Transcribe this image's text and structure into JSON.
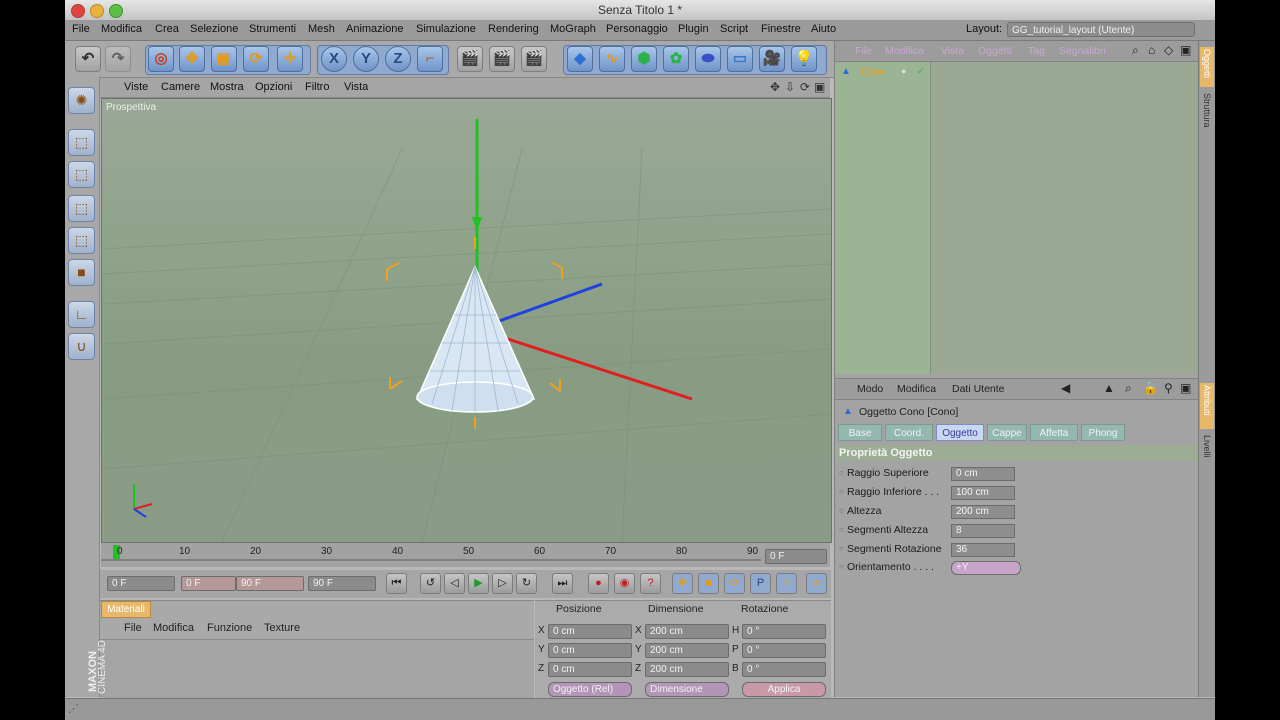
{
  "window": {
    "title": "Senza Titolo 1 *"
  },
  "menubar": {
    "items": [
      "File",
      "Modifica",
      "Crea",
      "Selezione",
      "Strumenti",
      "Mesh",
      "Animazione",
      "Simulazione",
      "Rendering",
      "MoGraph",
      "Personaggio",
      "Plugin",
      "Script",
      "Finestre",
      "Aiuto"
    ],
    "layout_label": "Layout:",
    "layout_value": "GG_tutorial_layout (Utente)"
  },
  "viewport": {
    "menu": [
      "Viste",
      "Camere",
      "Mostra",
      "Opzioni",
      "Filtro",
      "Vista"
    ],
    "label": "Prospettiva"
  },
  "timeline": {
    "ticks": [
      "0",
      "10",
      "20",
      "30",
      "40",
      "50",
      "60",
      "70",
      "80",
      "90"
    ],
    "current_frame": "0 F"
  },
  "playback": {
    "start": "0 F",
    "range_start": "0 F",
    "range_end": "90 F",
    "end": "90 F"
  },
  "materials": {
    "tab": "Materiali",
    "menu": [
      "File",
      "Modifica",
      "Funzione",
      "Texture"
    ]
  },
  "coordinates": {
    "headers": [
      "Posizione",
      "Dimensione",
      "Rotazione"
    ],
    "rows": [
      {
        "axis": "X",
        "pos": "0 cm",
        "dim_axis": "X",
        "dim": "200 cm",
        "rot_axis": "H",
        "rot": "0 °"
      },
      {
        "axis": "Y",
        "pos": "0 cm",
        "dim_axis": "Y",
        "dim": "200 cm",
        "rot_axis": "P",
        "rot": "0 °"
      },
      {
        "axis": "Z",
        "pos": "0 cm",
        "dim_axis": "Z",
        "dim": "200 cm",
        "rot_axis": "B",
        "rot": "0 °"
      }
    ],
    "mode_object": "Oggetto (Rel)",
    "mode_size": "Dimensione",
    "apply": "Applica"
  },
  "objects": {
    "menu": [
      "File",
      "Modifica",
      "Vista",
      "Oggetti",
      "Tag",
      "Segnalibri"
    ],
    "items": [
      {
        "name": "Cono"
      }
    ]
  },
  "attributes": {
    "menu": [
      "Modo",
      "Modifica",
      "Dati Utente"
    ],
    "object_title": "Oggetto Cono [Cono]",
    "tabs": [
      "Base",
      "Coord.",
      "Oggetto",
      "Cappe",
      "Affetta",
      "Phong"
    ],
    "active_tab": "Oggetto",
    "section": "Proprietà Oggetto",
    "props": [
      {
        "label": "Raggio Superiore",
        "value": "0 cm"
      },
      {
        "label": "Raggio Inferiore . . .",
        "value": "100 cm"
      },
      {
        "label": "Altezza",
        "value": "200 cm"
      },
      {
        "label": "Segmenti Altezza",
        "value": "8"
      },
      {
        "label": "Segmenti Rotazione",
        "value": "36"
      },
      {
        "label": "Orientamento . . . .",
        "value": "+Y"
      }
    ]
  },
  "side_tabs": [
    "Oggetti",
    "Struttura",
    "Attributi",
    "Livelli"
  ],
  "brand": {
    "maxon": "MAXON",
    "product": "CINEMA 4D"
  },
  "colors": {
    "selection_orange": "#f0a020",
    "axis_y": "#22c022",
    "axis_x": "#e02020",
    "axis_z": "#2040e0",
    "panel": "#a3a3a3"
  }
}
